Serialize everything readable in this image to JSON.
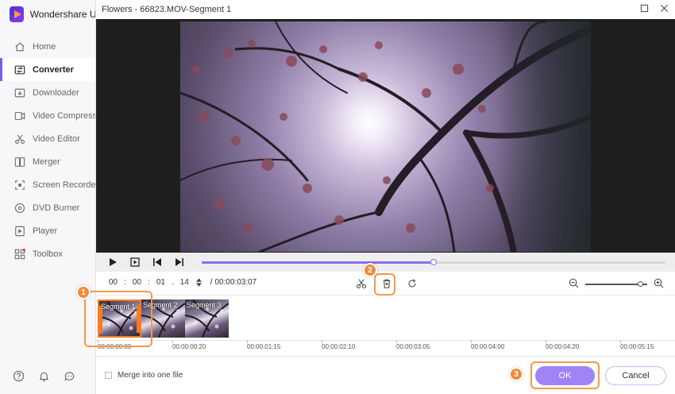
{
  "app": {
    "name": "Wondershare Uni"
  },
  "sidebar": {
    "items": [
      {
        "label": "Home",
        "icon": "home-icon",
        "active": false
      },
      {
        "label": "Converter",
        "icon": "converter-icon",
        "active": true
      },
      {
        "label": "Downloader",
        "icon": "download-icon",
        "active": false
      },
      {
        "label": "Video Compresso",
        "icon": "compress-icon",
        "active": false
      },
      {
        "label": "Video Editor",
        "icon": "scissors-icon",
        "active": false
      },
      {
        "label": "Merger",
        "icon": "merge-icon",
        "active": false
      },
      {
        "label": "Screen Recorder",
        "icon": "record-icon",
        "active": false
      },
      {
        "label": "DVD Burner",
        "icon": "disc-icon",
        "active": false
      },
      {
        "label": "Player",
        "icon": "player-icon",
        "active": false
      },
      {
        "label": "Toolbox",
        "icon": "grid-icon",
        "active": false
      }
    ],
    "bottom_icons": [
      "help-icon",
      "bell-icon",
      "feedback-icon"
    ]
  },
  "dialog": {
    "title": "Flowers - 66823.MOV-Segment 1",
    "playback": {
      "progress": 0.5
    },
    "timecode": {
      "hh": "00",
      "mm": "00",
      "ss": "01",
      "ff": "14",
      "duration": "/ 00:00:03:07"
    },
    "zoom_level": 0.88,
    "segments": [
      {
        "label": "Segment 1",
        "selected": true
      },
      {
        "label": "Segment 2",
        "selected": false
      },
      {
        "label": "Segment 3",
        "selected": false
      }
    ],
    "ruler": [
      "00:00:00:00",
      "00:00:00:20",
      "00:00:01:15",
      "00:00:02:10",
      "00:00:03:05",
      "00:00:04:00",
      "00:00:04:20",
      "00:00:05:15"
    ],
    "merge_label": "Merge into one file",
    "ok_label": "OK",
    "cancel_label": "Cancel"
  },
  "callouts": [
    "1",
    "2",
    "3"
  ],
  "colors": {
    "accent": "#8b6cf0",
    "highlight": "#f09a4a",
    "ok_button": "#a084f5"
  }
}
